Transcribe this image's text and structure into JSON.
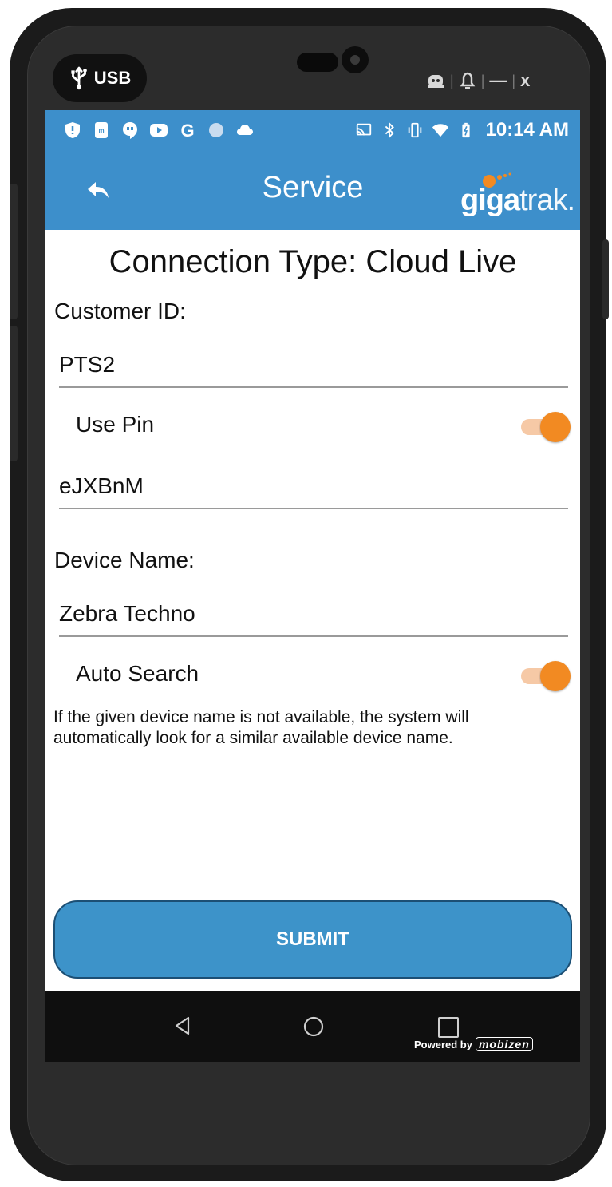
{
  "device": {
    "usb_label": "USB",
    "window_controls": [
      "restore",
      "notifications",
      "minimize",
      "close"
    ],
    "close_label": "x",
    "minimize_label": "—"
  },
  "status_bar": {
    "time": "10:14 AM",
    "left_icons": [
      "shield-icon",
      "app-icon",
      "hangouts-icon",
      "youtube-icon",
      "google-icon",
      "dot-icon",
      "cloud-icon"
    ],
    "right_icons": [
      "cast-icon",
      "bluetooth-icon",
      "vibrate-icon",
      "wifi-icon",
      "battery-icon"
    ]
  },
  "app_bar": {
    "title": "Service",
    "logo_text_bold": "giga",
    "logo_text_light": "trak.",
    "color": "#3d8fcb"
  },
  "form": {
    "heading": "Connection Type: Cloud Live",
    "customer_id_label": "Customer ID:",
    "customer_id_value": "PTS2",
    "use_pin_label": "Use Pin",
    "use_pin_on": true,
    "pin_value": "eJXBnM",
    "device_name_label": "Device Name:",
    "device_name_value": "Zebra Techno",
    "auto_search_label": "Auto Search",
    "auto_search_on": true,
    "note": "If the given device name is not available, the system will automatically look for a similar available device name."
  },
  "submit_label": "SUBMIT",
  "nav": {
    "powered_by": "Powered by",
    "powered_brand": "mobizen"
  },
  "colors": {
    "accent": "#3d8fcb",
    "toggle_on": "#f28a22",
    "submit_bg": "#3d93c9"
  }
}
